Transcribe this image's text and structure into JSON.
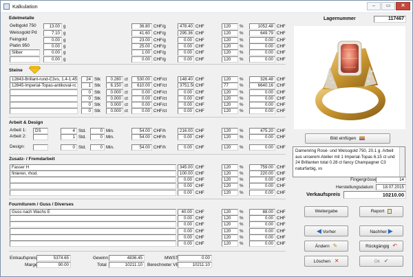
{
  "window": {
    "title": "Kalkulation",
    "min": "–",
    "max": "▭",
    "close": "✕"
  },
  "edel": {
    "title": "Edelmetalle",
    "unit_chf_g": "CHF/g",
    "unit_chf": "CHF",
    "unit_pct": "%",
    "unit_g": "g",
    "rows": [
      {
        "name": "Gelbgold 750",
        "qty": "13.00",
        "price": "36.80",
        "amount": "478.40",
        "pct": "120",
        "total": "1052.48"
      },
      {
        "name": "Weissgold Pd",
        "qty": "7.10",
        "price": "41.60",
        "amount": "295.36",
        "pct": "120",
        "total": "649.79"
      },
      {
        "name": "Feingold",
        "qty": "0.00",
        "price": "23.00",
        "amount": "0.00",
        "pct": "120",
        "total": "0.00"
      },
      {
        "name": "Platin 950",
        "qty": "0.00",
        "price": "25.00",
        "amount": "0.00",
        "pct": "120",
        "total": "0.00"
      },
      {
        "name": "Silber",
        "qty": "0.00",
        "price": "1.00",
        "amount": "0.00",
        "pct": "120",
        "total": "0.00"
      },
      {
        "name": "",
        "qty": "0.00",
        "price": "0.00",
        "amount": "0.00",
        "pct": "120",
        "total": "0.00"
      }
    ]
  },
  "steine": {
    "title": "Steine",
    "unit_stk": "Stk",
    "unit_ct": "ct",
    "unit_chfct": "CHF/ct",
    "unit_chf": "CHF",
    "unit_pct": "%",
    "rows": [
      {
        "name": "12843-Brillant-rund-C3vs, 1.4-1.45",
        "qty": "24",
        "ct": "0.280",
        "price": "530.00",
        "amount": "148.40",
        "pct": "120",
        "total": "326.48"
      },
      {
        "name": "12845-Imperial-Topas-antikoval-rc",
        "qty": "1",
        "ct": "6.150",
        "price": "610.00",
        "amount": "3751.50",
        "pct": "77",
        "total": "6640.16"
      },
      {
        "name": "",
        "qty": "0",
        "ct": "0.000",
        "price": "0.00",
        "amount": "0.00",
        "pct": "120",
        "total": "0.00"
      },
      {
        "name": "",
        "qty": "0",
        "ct": "0.000",
        "price": "0.00",
        "amount": "0.00",
        "pct": "120",
        "total": "0.00"
      },
      {
        "name": "",
        "qty": "0",
        "ct": "0.000",
        "price": "0.00",
        "amount": "0.00",
        "pct": "120",
        "total": "0.00"
      },
      {
        "name": "",
        "qty": "0",
        "ct": "0.000",
        "price": "0.00",
        "amount": "0.00",
        "pct": "120",
        "total": "0.00"
      }
    ]
  },
  "arbeit": {
    "title": "Arbeit & Design",
    "std": "Std.",
    "min": "Min.",
    "unit_chfh": "CHF/h",
    "unit_chf": "CHF",
    "unit_pct": "%",
    "rows": [
      {
        "label": "Arbeit 1:",
        "who": "DS",
        "hours": "4",
        "mins": "0",
        "rate": "54.00",
        "amount": "216.00",
        "pct": "120",
        "total": "475.20"
      },
      {
        "label": "Arbeit 2:",
        "who": "",
        "hours": "1",
        "mins": "0",
        "rate": "54.00",
        "amount": "0.00",
        "pct": "120",
        "total": "0.00"
      },
      {
        "label": "Design:",
        "who": "",
        "hours": "0",
        "mins": "0",
        "rate": "54.00",
        "amount": "0.00",
        "pct": "120",
        "total": "0.00"
      }
    ]
  },
  "zusatz": {
    "title": "Zusatz- / Fremdarbeit",
    "unit_chf": "CHF",
    "unit_pct": "%",
    "rows": [
      {
        "name": "Fasser H",
        "amount": "345.00",
        "pct": "120",
        "total": "759.00"
      },
      {
        "name": "finieren, rhod.",
        "amount": "100.00",
        "pct": "120",
        "total": "220.00"
      },
      {
        "name": "",
        "amount": "0.00",
        "pct": "120",
        "total": "0.00"
      },
      {
        "name": "",
        "amount": "0.00",
        "pct": "120",
        "total": "0.00"
      },
      {
        "name": "",
        "amount": "0.00",
        "pct": "120",
        "total": "0.00"
      }
    ]
  },
  "fourn": {
    "title": "Fourniturem / Guss / Diverses",
    "unit_chf": "CHF",
    "unit_pct": "%",
    "rows": [
      {
        "name": "Guss nach Wachs E",
        "amount": "40.00",
        "pct": "120",
        "total": "88.00"
      },
      {
        "name": "",
        "amount": "0.00",
        "pct": "120",
        "total": "0.00"
      },
      {
        "name": "",
        "amount": "0.00",
        "pct": "120",
        "total": "0.00"
      },
      {
        "name": "",
        "amount": "0.00",
        "pct": "120",
        "total": "0.00"
      },
      {
        "name": "",
        "amount": "0.00",
        "pct": "120",
        "total": "0.00"
      },
      {
        "name": "",
        "amount": "0.00",
        "pct": "120",
        "total": "0.00"
      }
    ]
  },
  "summary": {
    "einkauf_label": "Einkaufspreis",
    "einkauf": "5374.65",
    "marge_label": "Marge",
    "marge": "90.00",
    "gewinn_label": "Gewinn",
    "gewinn": "4836.45",
    "total_label": "Total",
    "total": "10211.10",
    "mwst_label": "MWST",
    "mwst": "0.00",
    "bvp_label": "Berechneter VP",
    "bvp": "10211.10"
  },
  "right": {
    "lager_label": "Lagernummer",
    "lager": "117467",
    "bild_btn": "Bild einfügen",
    "description": "Damenring Rosé- und Weissgold 750, 20.1 g. Arbeit aus unserem Atelier mit 1 Imperial-Topas 6.15 ct und 24 Brillanten total 0.28 ct fancy Champagner C3 naturfarbig, vs",
    "finger_label": "Fingergrösse",
    "finger": "14",
    "hdatum_label": "Herstellungsdatum",
    "hdatum": "18.07.2015",
    "vk_label": "Verkaufspreis",
    "vk": "10210.00"
  },
  "buttons": {
    "weitergabe": "Weitergabe",
    "report": "Report",
    "vorher": "Vorher",
    "nachher": "Nachher",
    "aendern": "Ändern",
    "rueck": "Rückgängig",
    "loeschen": "Löschen",
    "ok": "Ok"
  },
  "colors": {
    "gem": "#f5c11a",
    "arrow": "#2a66b8",
    "delete": "#c0392b",
    "ok": "#7a9a7a"
  }
}
